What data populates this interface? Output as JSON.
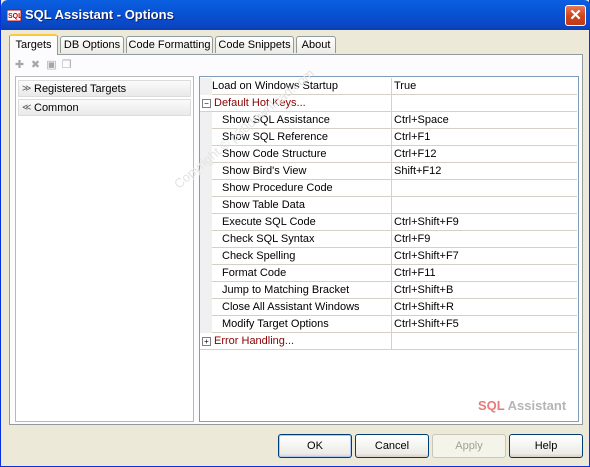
{
  "window": {
    "title": "SQL Assistant - Options",
    "close_glyph": "✕",
    "app_icon": "sql-assistant-icon"
  },
  "tabs": [
    {
      "label": "Targets",
      "active": true
    },
    {
      "label": "DB Options",
      "active": false
    },
    {
      "label": "Code Formatting",
      "active": false
    },
    {
      "label": "Code Snippets",
      "active": false
    },
    {
      "label": "About",
      "active": false
    }
  ],
  "toolbar": {
    "icons": [
      "add-icon",
      "delete-icon",
      "edit-icon",
      "copy-icon"
    ],
    "glyphs": [
      "✚",
      "✖",
      "▣",
      "❐"
    ]
  },
  "left_panel": {
    "groups": [
      {
        "label": "Registered Targets",
        "chevron": "≫"
      },
      {
        "label": "Common",
        "chevron": "≪"
      }
    ]
  },
  "properties": {
    "rows": [
      {
        "name": "Load on Windows Startup",
        "value": "True",
        "kind": "plain"
      },
      {
        "name": "Default Hot Keys...",
        "value": "",
        "kind": "category",
        "expander": "−"
      },
      {
        "name": "Show SQL Assistance",
        "value": "Ctrl+Space",
        "kind": "sub"
      },
      {
        "name": "Show SQL Reference",
        "value": "Ctrl+F1",
        "kind": "sub"
      },
      {
        "name": "Show Code Structure",
        "value": "Ctrl+F12",
        "kind": "sub"
      },
      {
        "name": "Show Bird's View",
        "value": "Shift+F12",
        "kind": "sub"
      },
      {
        "name": "Show Procedure Code",
        "value": "",
        "kind": "sub"
      },
      {
        "name": "Show Table Data",
        "value": "",
        "kind": "sub"
      },
      {
        "name": "Execute SQL Code",
        "value": "Ctrl+Shift+F9",
        "kind": "sub"
      },
      {
        "name": "Check SQL Syntax",
        "value": "Ctrl+F9",
        "kind": "sub"
      },
      {
        "name": "Check Spelling",
        "value": "Ctrl+Shift+F7",
        "kind": "sub"
      },
      {
        "name": "Format Code",
        "value": "Ctrl+F11",
        "kind": "sub"
      },
      {
        "name": "Jump to Matching Bracket",
        "value": "Ctrl+Shift+B",
        "kind": "sub"
      },
      {
        "name": "Close All Assistant Windows",
        "value": "Ctrl+Shift+R",
        "kind": "sub"
      },
      {
        "name": "Modify Target Options",
        "value": "Ctrl+Shift+F5",
        "kind": "sub"
      },
      {
        "name": "Error Handling...",
        "value": "",
        "kind": "category",
        "expander": "+"
      }
    ]
  },
  "watermark": "Copyright © p30download.com",
  "brand": {
    "part1": "SQL",
    "part2": " Assistant"
  },
  "buttons": {
    "ok": "OK",
    "cancel": "Cancel",
    "apply": "Apply",
    "help": "Help"
  }
}
